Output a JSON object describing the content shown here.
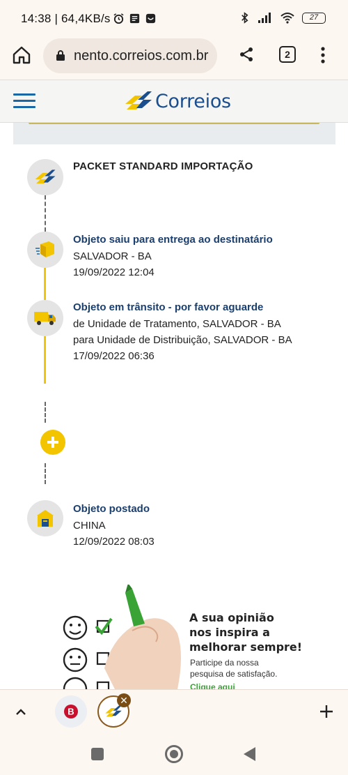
{
  "status_bar": {
    "time": "14:38",
    "speed": "| 64,4KB/s",
    "battery": "27",
    "icons": [
      "alarm-icon",
      "news-icon",
      "app-icon",
      "bluetooth-icon",
      "signal-icon",
      "wifi-icon",
      "battery-icon"
    ]
  },
  "browser": {
    "url": "nento.correios.com.br",
    "tab_count": "2",
    "icons": [
      "home-icon",
      "lock-icon",
      "share-icon",
      "overflow-menu-icon"
    ]
  },
  "site": {
    "logo_text": "Correios",
    "brand_colors": {
      "blue": "#1a4e8c",
      "yellow": "#f2c500"
    }
  },
  "tracking": {
    "product": "PACKET STANDARD IMPORTAÇÃO",
    "events": [
      {
        "title": "Objeto saiu para entrega ao destinatário",
        "lines": [
          "SALVADOR - BA",
          "19/09/2022 12:04"
        ],
        "icon": "delivery-box-icon"
      },
      {
        "title": "Objeto em trânsito - por favor aguarde",
        "lines": [
          "de Unidade de Tratamento, SALVADOR - BA",
          "para Unidade de Distribuição, SALVADOR - BA",
          "17/09/2022 06:36"
        ],
        "icon": "truck-icon"
      },
      {
        "title": "Objeto postado",
        "lines": [
          "CHINA",
          "12/09/2022 08:03"
        ],
        "icon": "post-office-icon"
      }
    ]
  },
  "banner": {
    "headline": [
      "A sua opinião",
      "nos inspira a",
      "melhorar sempre!"
    ],
    "sub": [
      "Participe da nossa",
      "pesquisa de satisfação."
    ],
    "link": "Clique aqui"
  },
  "tab_strip": {
    "tab1_letter": "B",
    "close": "✕"
  }
}
